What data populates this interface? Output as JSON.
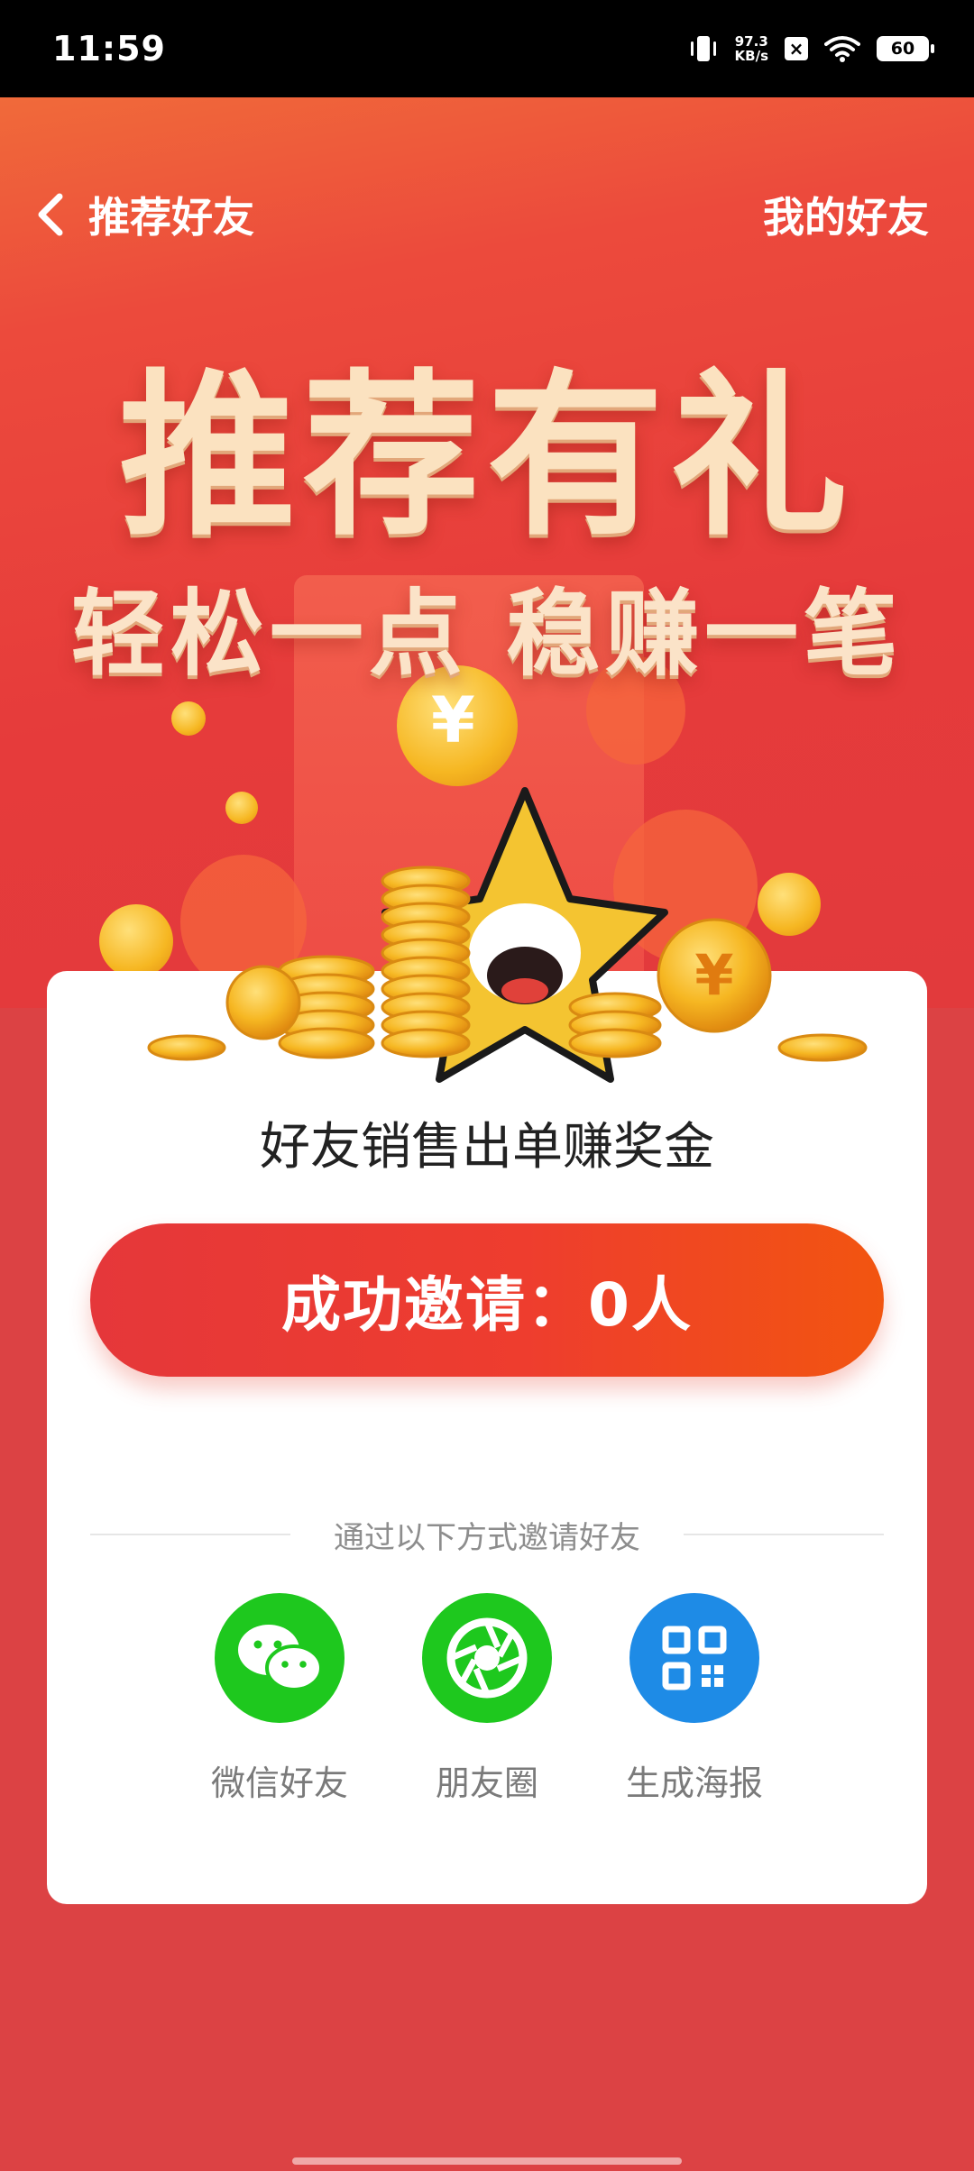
{
  "status_bar": {
    "time": "11:59",
    "net_speed_value": "97.3",
    "net_speed_unit": "KB/s",
    "battery": "60"
  },
  "nav": {
    "title": "推荐好友",
    "right_link": "我的好友"
  },
  "banner": {
    "headline": "推荐有礼",
    "subheadline": "轻松一点 稳赚一笔",
    "coin_symbol": "¥"
  },
  "card": {
    "title": "好友销售出单赚奖金",
    "invite_status": "成功邀请：0人",
    "divider_text": "通过以下方式邀请好友",
    "share_options": [
      {
        "label": "微信好友",
        "icon": "wechat-icon",
        "color": "#1ec81e"
      },
      {
        "label": "朋友圈",
        "icon": "moments-icon",
        "color": "#1ec81e"
      },
      {
        "label": "生成海报",
        "icon": "qrcode-icon",
        "color": "#1e8be6"
      }
    ]
  }
}
